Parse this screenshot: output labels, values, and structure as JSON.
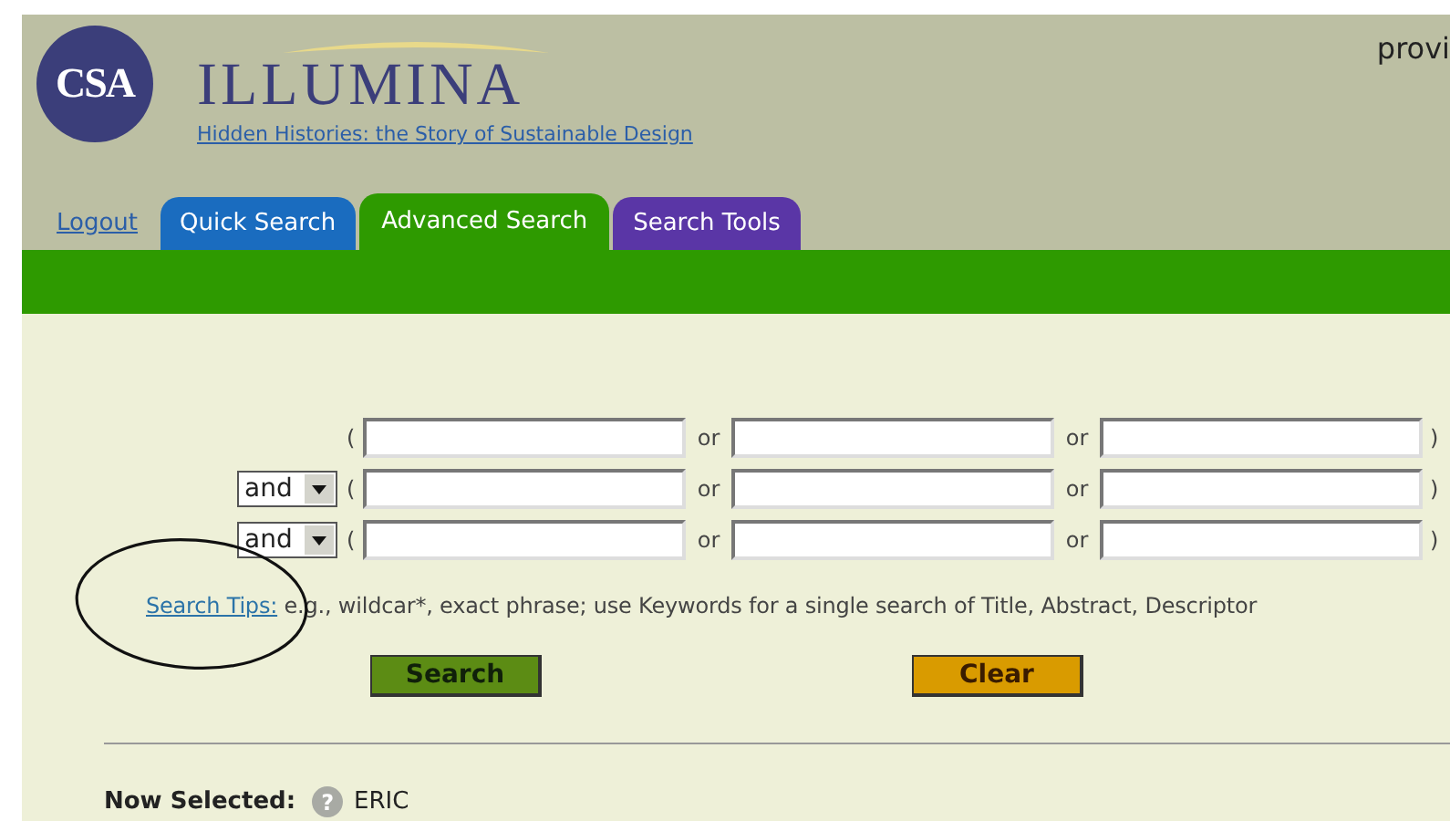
{
  "header": {
    "logo": "CSA",
    "title": "ILLUMINA",
    "subtitle_link": "Hidden Histories: the Story of Sustainable Design",
    "top_right": "provi"
  },
  "nav": {
    "logout": "Logout",
    "tabs": [
      {
        "label": "Quick Search",
        "selected": false,
        "color": "#1a6cbf"
      },
      {
        "label": "Advanced Search",
        "selected": true,
        "color": "#2e9a00"
      },
      {
        "label": "Search Tools",
        "selected": false,
        "color": "#5a36a6"
      }
    ]
  },
  "search_rows": [
    {
      "kind": "first",
      "open": "(",
      "separators": [
        "or",
        "or"
      ],
      "close": ")"
    },
    {
      "kind": "joined",
      "operator": "and",
      "open": "(",
      "separators": [
        "or",
        "or"
      ],
      "close": ")"
    },
    {
      "kind": "joined",
      "operator": "and",
      "open": "(",
      "separators": [
        "or",
        "or"
      ],
      "close": ")"
    }
  ],
  "tips": {
    "link": "Search Tips:",
    "text": "e.g., wildcar*, exact phrase; use Keywords for a single search of Title, Abstract, Descriptor"
  },
  "buttons": [
    {
      "label": "Search",
      "kind": "search"
    },
    {
      "label": "Clear",
      "kind": "clear"
    }
  ],
  "now_selected": {
    "label": "Now Selected:",
    "help_icon": "?",
    "value": "ERIC"
  }
}
